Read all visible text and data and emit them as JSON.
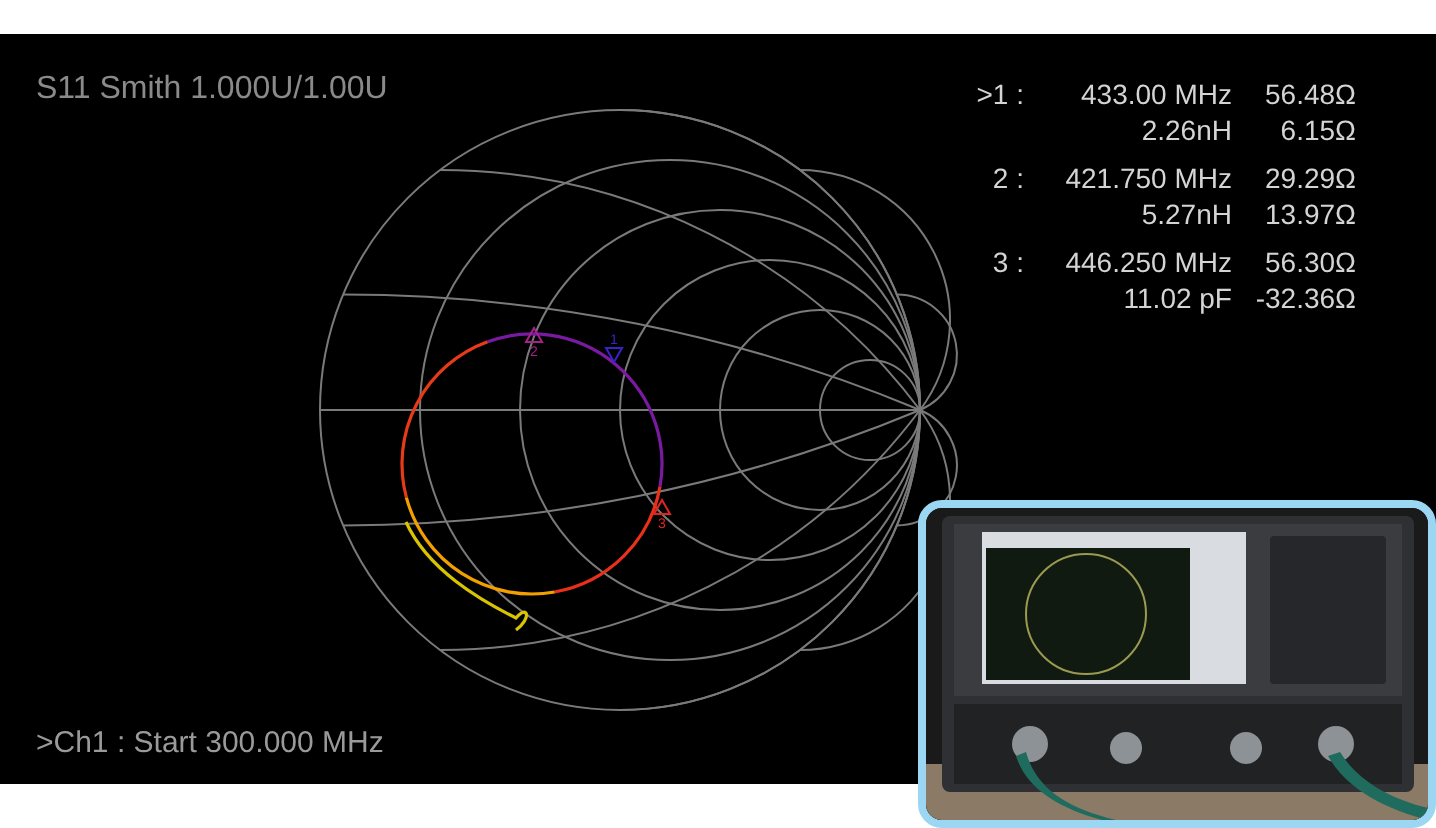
{
  "display": {
    "title": "S11 Smith 1.000U/1.00U",
    "readouts": [
      {
        "label": ">1 :",
        "frequency": "433.00 MHz",
        "resistance": "56.48Ω",
        "equivalent": "2.26nH",
        "reactance": "6.15Ω"
      },
      {
        "label": "2 :",
        "frequency": "421.750 MHz",
        "resistance": "29.29Ω",
        "equivalent": "5.27nH",
        "reactance": "13.97Ω"
      },
      {
        "label": "3 :",
        "frequency": "446.250 MHz",
        "resistance": "56.30Ω",
        "equivalent": "11.02 pF",
        "reactance": "-32.36Ω"
      }
    ],
    "chart_markers": [
      {
        "number": "1",
        "kind": "down",
        "color": "#3a22c8"
      },
      {
        "number": "2",
        "kind": "up",
        "color": "#a8208c"
      },
      {
        "number": "3",
        "kind": "up",
        "color": "#e02424"
      }
    ],
    "status": ">Ch1 : Start 300.000 MHz"
  }
}
